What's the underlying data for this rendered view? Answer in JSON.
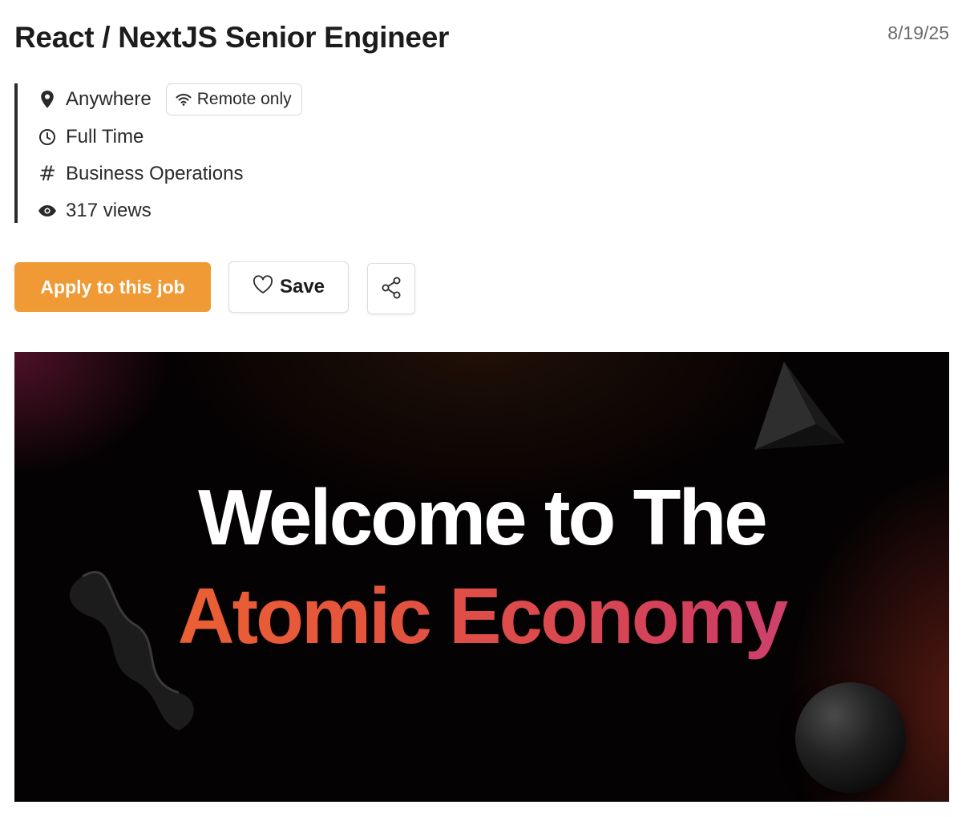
{
  "job": {
    "title": "React / NextJS Senior Engineer",
    "posted_date": "8/19/25",
    "location": "Anywhere",
    "remote_badge": "Remote only",
    "employment_type": "Full Time",
    "category": "Business Operations",
    "views": "317 views"
  },
  "actions": {
    "apply_label": "Apply to this job",
    "save_label": "Save",
    "share_icon": "share-icon"
  },
  "banner": {
    "line1": "Welcome to The",
    "line2": "Atomic Economy"
  },
  "colors": {
    "apply_button": "#f09a36",
    "banner_background": "#050203",
    "headline_gradient_start": "#ef6a2c",
    "headline_gradient_end": "#c8488a"
  }
}
